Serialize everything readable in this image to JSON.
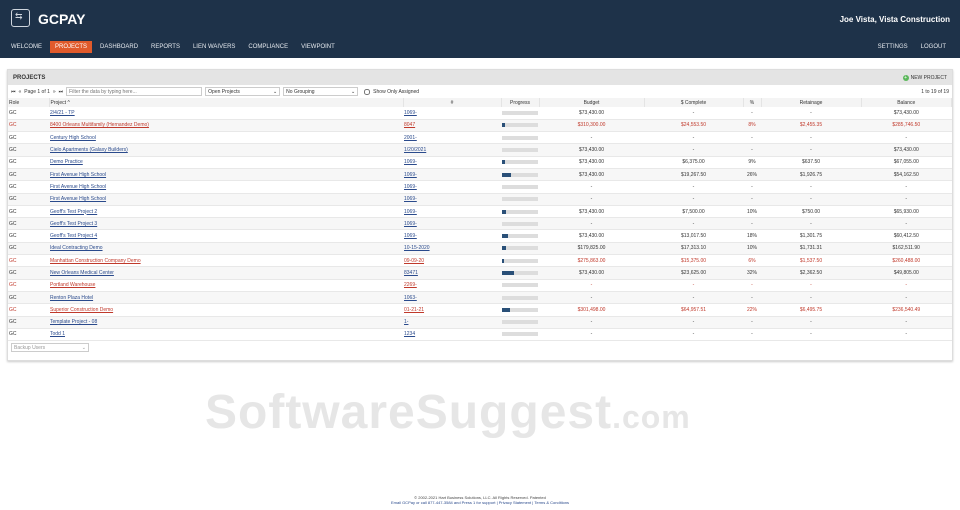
{
  "brand": "GCPAY",
  "user": "Joe Vista, Vista Construction",
  "nav": [
    "WELCOME",
    "PROJECTS",
    "DASHBOARD",
    "REPORTS",
    "LIEN WAIVERS",
    "COMPLIANCE",
    "VIEWPOINT"
  ],
  "nav_right": [
    "SETTINGS",
    "LOGOUT"
  ],
  "panel": {
    "title": "PROJECTS",
    "new_project": "NEW PROJECT",
    "page": "Page 1 of 1",
    "filter_placeholder": "Filter the data by typing here...",
    "status_select": "Open Projects",
    "grouping_select": "No Grouping",
    "show_assigned": "Show Only Assigned",
    "count": "1 to 19 of 19",
    "backup_users": "Backup Users"
  },
  "columns": [
    "Role",
    "Project ^",
    "#",
    "Progress",
    "Budget",
    "$ Complete",
    "%",
    "Retainage",
    "Balance"
  ],
  "rows": [
    {
      "role": "GC",
      "project": "2/4/21 - TP",
      "num": "1069-",
      "pct_fill": 0,
      "budget": "$73,430.00",
      "complete": "-",
      "pct": "-",
      "ret": "-",
      "bal": "$73,430.00",
      "red": false
    },
    {
      "role": "GC",
      "project": "8400 Orleans Multifamily (Hernandez Demo)",
      "num": "8047",
      "pct_fill": 8,
      "budget": "$310,300.00",
      "complete": "$24,553.50",
      "pct": "8%",
      "ret": "$2,455.35",
      "bal": "$285,746.50",
      "red": true
    },
    {
      "role": "GC",
      "project": "Century High School",
      "num": "2001-",
      "pct_fill": 0,
      "budget": "-",
      "complete": "-",
      "pct": "-",
      "ret": "-",
      "bal": "-",
      "red": false
    },
    {
      "role": "GC",
      "project": "Cielo Apartments (Galaxy Builders)",
      "num": "1/20/2021",
      "pct_fill": 0,
      "budget": "$73,430.00",
      "complete": "-",
      "pct": "-",
      "ret": "-",
      "bal": "$73,430.00",
      "red": false
    },
    {
      "role": "GC",
      "project": "Demo Practice",
      "num": "1069-",
      "pct_fill": 9,
      "budget": "$73,430.00",
      "complete": "$6,375.00",
      "pct": "9%",
      "ret": "$637.50",
      "bal": "$67,055.00",
      "red": false
    },
    {
      "role": "GC",
      "project": "First Avenue High School",
      "num": "1069-",
      "pct_fill": 26,
      "budget": "$73,430.00",
      "complete": "$19,267.50",
      "pct": "26%",
      "ret": "$1,926.75",
      "bal": "$54,162.50",
      "red": false
    },
    {
      "role": "GC",
      "project": "First Avenue High School",
      "num": "1069-",
      "pct_fill": 0,
      "budget": "-",
      "complete": "-",
      "pct": "-",
      "ret": "-",
      "bal": "-",
      "red": false
    },
    {
      "role": "GC",
      "project": "First Avenue High School",
      "num": "1069-",
      "pct_fill": 0,
      "budget": "-",
      "complete": "-",
      "pct": "-",
      "ret": "-",
      "bal": "-",
      "red": false
    },
    {
      "role": "GC",
      "project": "Geoff's Test Project 2",
      "num": "1069-",
      "pct_fill": 10,
      "budget": "$73,430.00",
      "complete": "$7,500.00",
      "pct": "10%",
      "ret": "$750.00",
      "bal": "$65,930.00",
      "red": false
    },
    {
      "role": "GC",
      "project": "Geoff's Test Project 3",
      "num": "1069-",
      "pct_fill": 0,
      "budget": "-",
      "complete": "-",
      "pct": "-",
      "ret": "-",
      "bal": "-",
      "red": false
    },
    {
      "role": "GC",
      "project": "Geoff's Test Project 4",
      "num": "1069-",
      "pct_fill": 18,
      "budget": "$73,430.00",
      "complete": "$13,017.50",
      "pct": "18%",
      "ret": "$1,301.75",
      "bal": "$60,412.50",
      "red": false
    },
    {
      "role": "GC",
      "project": "Ideal Contracting Demo",
      "num": "10-15-2020",
      "pct_fill": 10,
      "budget": "$179,825.00",
      "complete": "$17,313.10",
      "pct": "10%",
      "ret": "$1,731.31",
      "bal": "$162,511.90",
      "red": false
    },
    {
      "role": "GC",
      "project": "Manhattan Construction Company Demo",
      "num": "09-09-20",
      "pct_fill": 6,
      "budget": "$275,863.00",
      "complete": "$15,375.00",
      "pct": "6%",
      "ret": "$1,537.50",
      "bal": "$260,488.00",
      "red": true
    },
    {
      "role": "GC",
      "project": "New Orleans Medical Center",
      "num": "83471",
      "pct_fill": 32,
      "budget": "$73,430.00",
      "complete": "$23,625.00",
      "pct": "32%",
      "ret": "$2,362.50",
      "bal": "$49,805.00",
      "red": false
    },
    {
      "role": "GC",
      "project": "Portland Warehouse",
      "num": "2269-",
      "pct_fill": 0,
      "budget": "-",
      "complete": "-",
      "pct": "-",
      "ret": "-",
      "bal": "-",
      "red": true
    },
    {
      "role": "GC",
      "project": "Renton Plaza Hotel",
      "num": "1063-",
      "pct_fill": 0,
      "budget": "-",
      "complete": "-",
      "pct": "-",
      "ret": "-",
      "bal": "-",
      "red": false
    },
    {
      "role": "GC",
      "project": "Superior Construction Demo",
      "num": "01-21-21",
      "pct_fill": 22,
      "budget": "$301,498.00",
      "complete": "$64,957.51",
      "pct": "22%",
      "ret": "$6,495.75",
      "bal": "$236,540.49",
      "red": true
    },
    {
      "role": "GC",
      "project": "Template Project - 08",
      "num": "1-",
      "pct_fill": 0,
      "budget": "-",
      "complete": "-",
      "pct": "-",
      "ret": "-",
      "bal": "-",
      "red": false
    },
    {
      "role": "GC",
      "project": "Todd 1",
      "num": "1234",
      "pct_fill": 0,
      "budget": "-",
      "complete": "-",
      "pct": "-",
      "ret": "-",
      "bal": "-",
      "red": false
    }
  ],
  "watermark": {
    "main": "SoftwareSuggest",
    "suffix": ".com"
  },
  "footer": {
    "line1": "© 2002-2021 Hart Business Solutions, LLC. All Rights Reserved. Patented",
    "line2": "Email GCPay or call 877-447-3584 and Press 1 for support | Privacy Statement | Terms & Conditions"
  }
}
